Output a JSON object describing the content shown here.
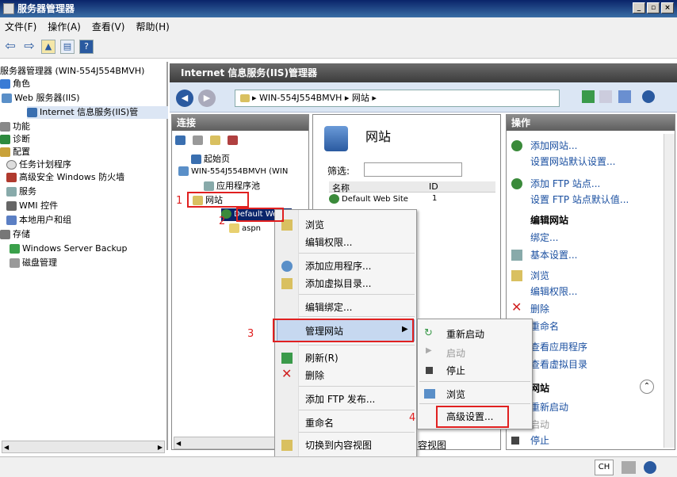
{
  "window": {
    "title": "服务器管理器",
    "btn_min": "_",
    "btn_max": "▫",
    "btn_close": "×"
  },
  "menu": [
    "文件(F)",
    "操作(A)",
    "查看(V)",
    "帮助(H)"
  ],
  "toolbar": {
    "help_label": "?"
  },
  "left_tree": {
    "root": "服务器管理器 (WIN-554J554BMVH)",
    "roles": "角色",
    "web_server": "Web 服务器(IIS)",
    "iis_manager": "Internet 信息服务(IIS)管",
    "features": "功能",
    "diagnostics": "诊断",
    "config": "配置",
    "task_scheduler": "任务计划程序",
    "firewall": "高级安全 Windows 防火墙",
    "services": "服务",
    "wmi": "WMI 控件",
    "local_users": "本地用户和组",
    "storage": "存储",
    "backup": "Windows Server Backup",
    "disk_mgmt": "磁盘管理"
  },
  "iis": {
    "header": "Internet 信息服务(IIS)管理器",
    "breadcrumb": "▸ WIN-554J554BMVH ▸ 网站 ▸"
  },
  "connections": {
    "header": "连接",
    "start_page": "起始页",
    "server": "WIN-554J554BMVH (WIN",
    "app_pools": "应用程序池",
    "sites": "网站",
    "default_site": "Default Web S",
    "aspnet": "aspn"
  },
  "center": {
    "title": "网站",
    "filter_label": "筛选:",
    "col_name": "名称",
    "col_id": "ID",
    "row_name": "Default Web Site",
    "row_id": "1",
    "content_view": "容视图"
  },
  "actions": {
    "header": "操作",
    "add_site": "添加网站...",
    "site_defaults": "设置网站默认设置...",
    "add_ftp": "添加 FTP 站点...",
    "ftp_defaults": "设置 FTP 站点默认值...",
    "edit_site": "编辑网站",
    "bindings": "绑定...",
    "basic_settings": "基本设置...",
    "browse": "浏览",
    "edit_perms": "编辑权限...",
    "delete": "删除",
    "rename": "重命名",
    "view_apps": "查看应用程序",
    "view_vdirs": "查看虚拟目录",
    "manage_site": "网站",
    "restart": "重新启动",
    "start": "启动",
    "stop": "停止"
  },
  "context_menu": {
    "browse": "浏览",
    "edit_perms": "编辑权限...",
    "add_app": "添加应用程序...",
    "add_vdir": "添加虚拟目录...",
    "edit_bindings": "编辑绑定...",
    "manage_site": "管理网站",
    "refresh": "刷新(R)",
    "delete": "删除",
    "add_ftp": "添加 FTP 发布...",
    "rename": "重命名",
    "switch_content": "切换到内容视图"
  },
  "submenu": {
    "restart": "重新启动",
    "start": "启动",
    "stop": "停止",
    "browse": "浏览",
    "advanced": "高级设置..."
  },
  "annotations": {
    "n1": "1",
    "n2": "2",
    "n3": "3",
    "n4": "4"
  },
  "status": {
    "lang": "CH"
  },
  "colors": {
    "annotation": "#e02020",
    "highlight": "#c6d8f0",
    "link": "#1a4fa0"
  }
}
